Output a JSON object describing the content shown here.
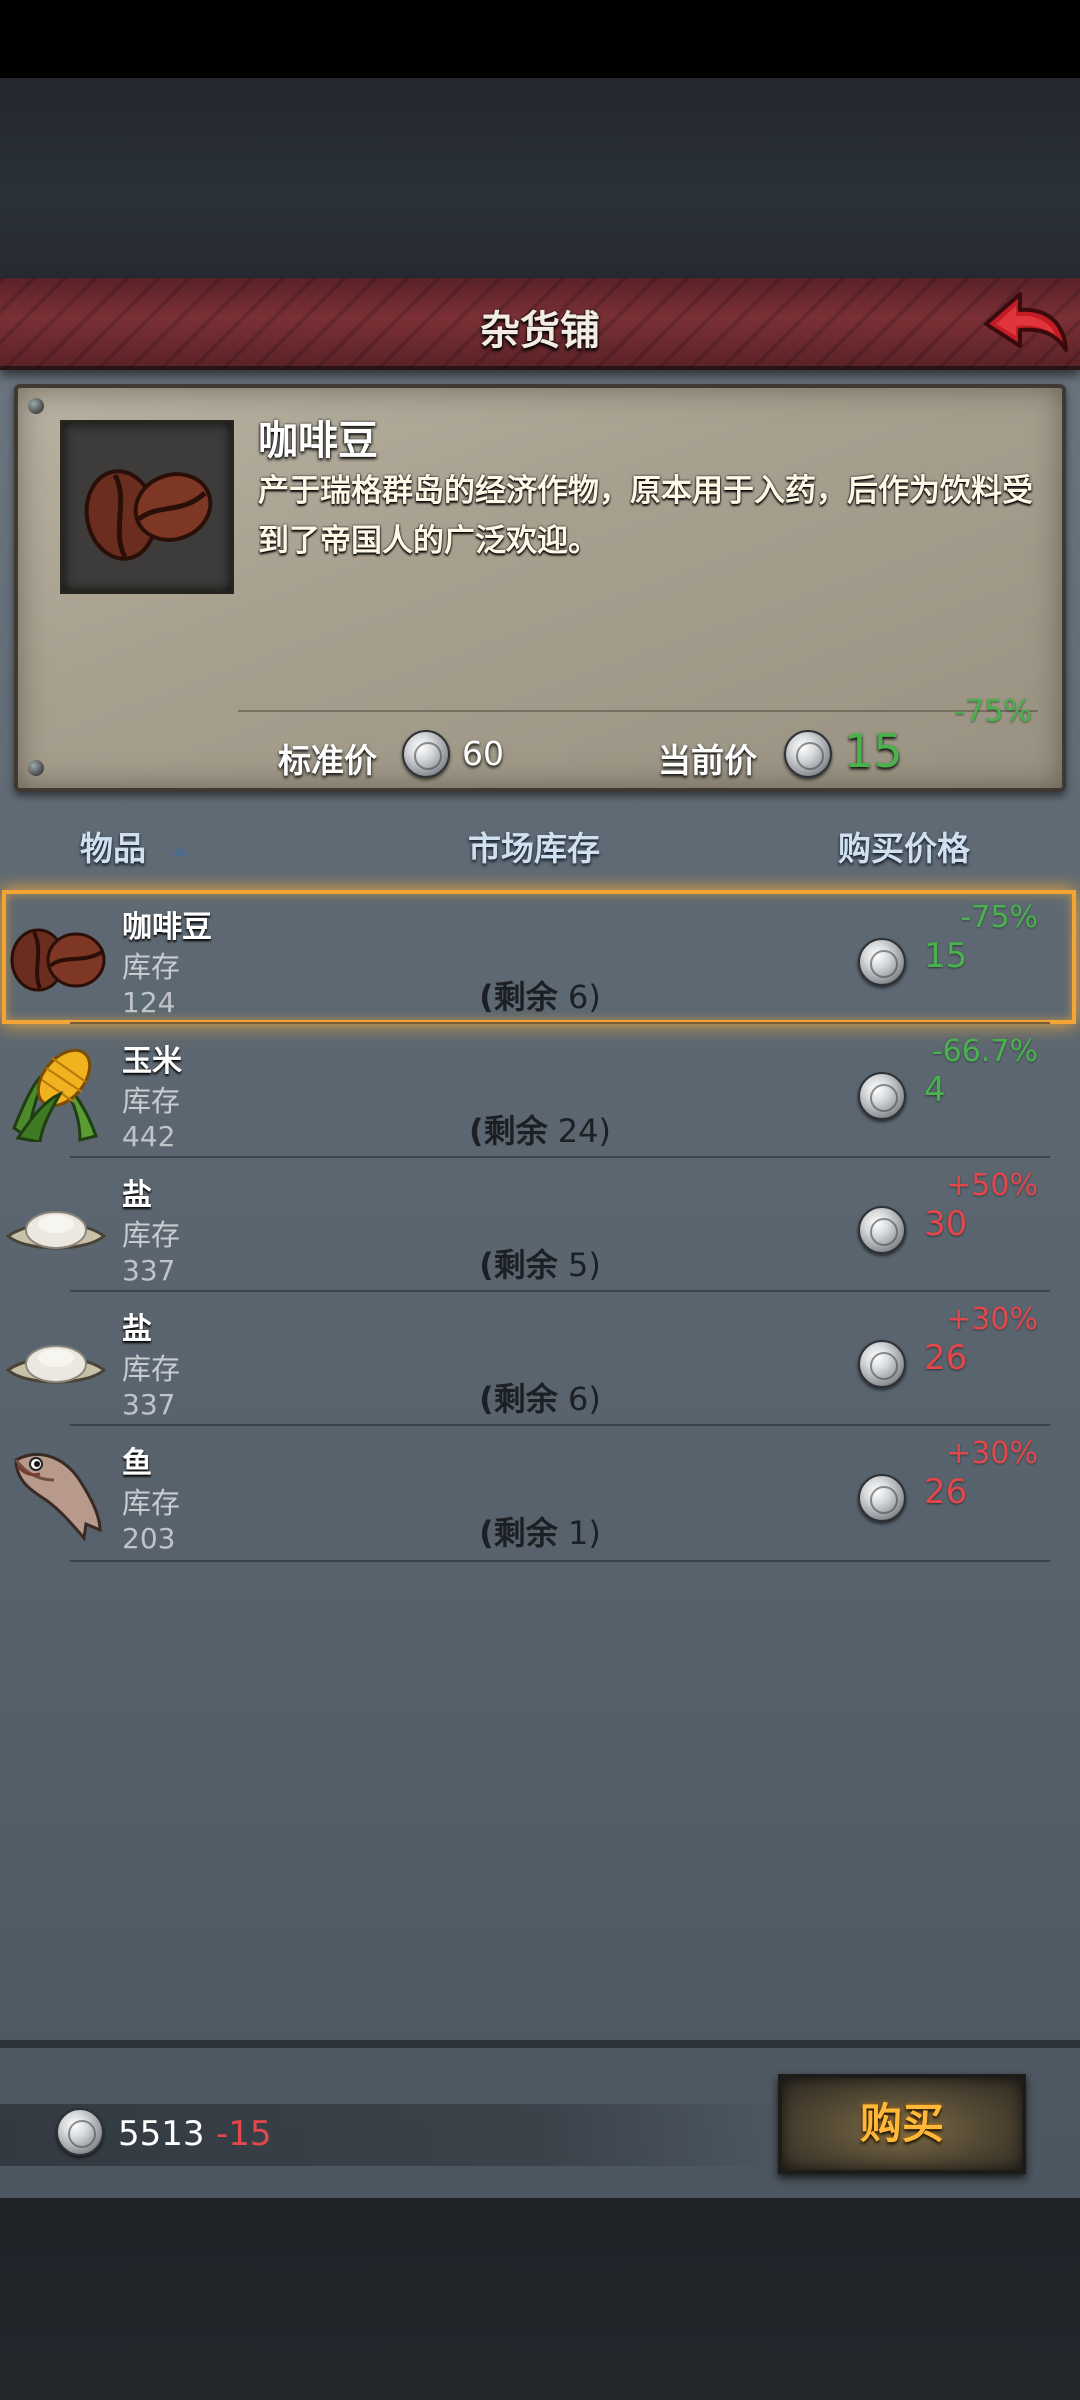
{
  "header": {
    "title": "杂货铺",
    "back_icon": "back-arrow-icon"
  },
  "detail": {
    "name": "咖啡豆",
    "description": "产于瑞格群岛的经济作物，原本用于入药，后作为饮料受到了帝国人的广泛欢迎。",
    "discount": "-75%",
    "standard_price_label": "标准价",
    "standard_price": "60",
    "current_price_label": "当前价",
    "current_price": "15"
  },
  "columns": {
    "item": "物品",
    "market_stock": "市场库存",
    "buy_price": "购买价格"
  },
  "items": [
    {
      "name": "咖啡豆",
      "stock_label": "库存",
      "stock": "124",
      "remain_label": "(剩余",
      "remain": "6)",
      "discount": "-75%",
      "price": "15",
      "trend": "down",
      "icon": "coffee-beans-icon"
    },
    {
      "name": "玉米",
      "stock_label": "库存",
      "stock": "442",
      "remain_label": "(剩余",
      "remain": "24)",
      "discount": "-66.7%",
      "price": "4",
      "trend": "down",
      "icon": "corn-icon"
    },
    {
      "name": "盐",
      "stock_label": "库存",
      "stock": "337",
      "remain_label": "(剩余",
      "remain": "5)",
      "discount": "+50%",
      "price": "30",
      "trend": "up",
      "icon": "salt-icon"
    },
    {
      "name": "盐",
      "stock_label": "库存",
      "stock": "337",
      "remain_label": "(剩余",
      "remain": "6)",
      "discount": "+30%",
      "price": "26",
      "trend": "up",
      "icon": "salt-icon"
    },
    {
      "name": "鱼",
      "stock_label": "库存",
      "stock": "203",
      "remain_label": "(剩余",
      "remain": "1)",
      "discount": "+30%",
      "price": "26",
      "trend": "up",
      "icon": "fish-icon"
    }
  ],
  "footer": {
    "money": "5513",
    "delta": "-15",
    "buy_label": "购买"
  },
  "colors": {
    "discount_green": "#49b24d",
    "markup_red": "#e0484b",
    "select_orange": "#f2a534",
    "buy_text": "#ffb838"
  }
}
